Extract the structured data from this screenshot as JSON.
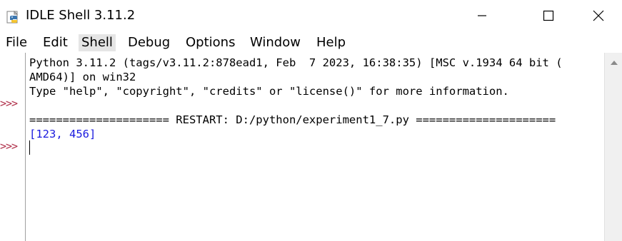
{
  "window": {
    "title": "IDLE Shell 3.11.2",
    "minimize_icon": "minimize-icon",
    "maximize_icon": "maximize-icon",
    "close_icon": "close-icon"
  },
  "menu": {
    "items": [
      "File",
      "Edit",
      "Shell",
      "Debug",
      "Options",
      "Window",
      "Help"
    ],
    "active": "Shell"
  },
  "shell": {
    "prompt": ">>>",
    "lines": [
      "Python 3.11.2 (tags/v3.11.2:878ead1, Feb  7 2023, 16:38:35) [MSC v.1934 64 bit (",
      "AMD64)] on win32",
      "Type \"help\", \"copyright\", \"credits\" or \"license()\" for more information.",
      "===================== RESTART: D:/python/experiment1_7.py ====================="
    ],
    "output": "[123, 456]"
  },
  "colors": {
    "prompt": "#b0304a",
    "output": "#1a1adf"
  }
}
